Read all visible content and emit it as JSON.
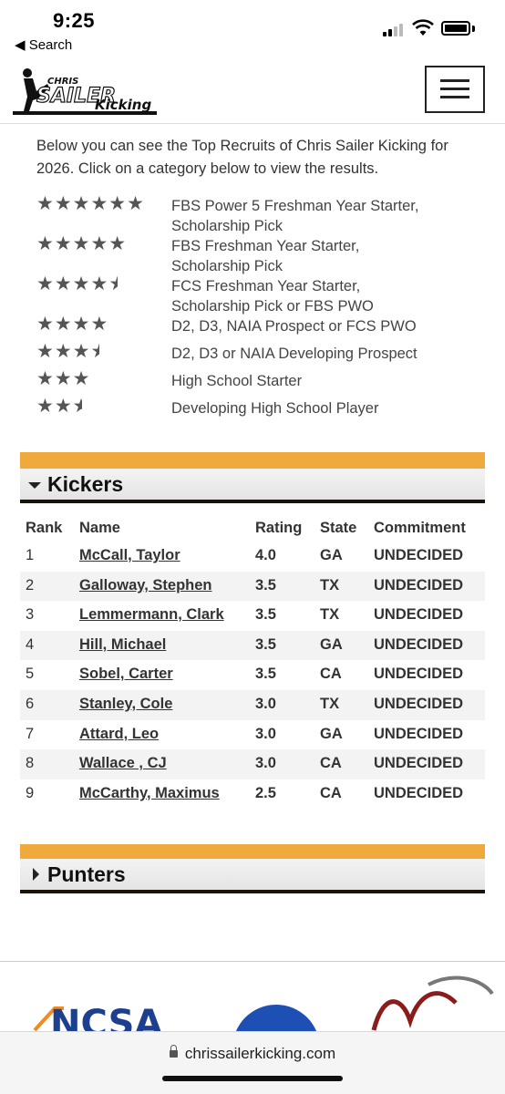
{
  "status_bar": {
    "time": "9:25",
    "back_label": "◀ Search"
  },
  "header": {
    "logo_text_top": "CHRIS",
    "logo_text_main": "SAILER",
    "logo_text_sub": "Kicking"
  },
  "intro": {
    "text": "Below you can see the Top Recruits of Chris Sailer Kicking for 2026. Click on a category below to view the results."
  },
  "legend": [
    {
      "stars": 6,
      "half": false,
      "label_lines": [
        "FBS Power 5 Freshman Year Starter,",
        "Scholarship Pick"
      ]
    },
    {
      "stars": 5,
      "half": false,
      "label_lines": [
        "FBS Freshman Year Starter,",
        "Scholarship Pick"
      ]
    },
    {
      "stars": 4,
      "half": true,
      "label_lines": [
        "FCS Freshman Year Starter,",
        "Scholarship Pick or FBS PWO"
      ]
    },
    {
      "stars": 4,
      "half": false,
      "label_lines": [
        "D2, D3, NAIA Prospect or FCS PWO"
      ]
    },
    {
      "stars": 3,
      "half": true,
      "label_lines": [
        "D2, D3 or NAIA Developing Prospect"
      ]
    },
    {
      "stars": 3,
      "half": false,
      "label_lines": [
        "High School Starter"
      ]
    },
    {
      "stars": 2,
      "half": true,
      "label_lines": [
        "Developing High School Player"
      ]
    }
  ],
  "kickers": {
    "title": "Kickers",
    "columns": [
      "Rank",
      "Name",
      "Rating",
      "State",
      "Commitment"
    ],
    "rows": [
      {
        "rank": "1",
        "name": "McCall, Taylor",
        "rating": "4.0",
        "state": "GA",
        "commitment": "UNDECIDED"
      },
      {
        "rank": "2",
        "name": "Galloway, Stephen",
        "rating": "3.5",
        "state": "TX",
        "commitment": "UNDECIDED"
      },
      {
        "rank": "3",
        "name": "Lemmermann, Clark",
        "rating": "3.5",
        "state": "TX",
        "commitment": "UNDECIDED"
      },
      {
        "rank": "4",
        "name": "Hill, Michael",
        "rating": "3.5",
        "state": "GA",
        "commitment": "UNDECIDED"
      },
      {
        "rank": "5",
        "name": "Sobel, Carter",
        "rating": "3.5",
        "state": "CA",
        "commitment": "UNDECIDED"
      },
      {
        "rank": "6",
        "name": "Stanley, Cole",
        "rating": "3.0",
        "state": "TX",
        "commitment": "UNDECIDED"
      },
      {
        "rank": "7",
        "name": "Attard, Leo",
        "rating": "3.0",
        "state": "GA",
        "commitment": "UNDECIDED"
      },
      {
        "rank": "8",
        "name": "Wallace , CJ",
        "rating": "3.0",
        "state": "CA",
        "commitment": "UNDECIDED"
      },
      {
        "rank": "9",
        "name": "McCarthy, Maximus",
        "rating": "2.5",
        "state": "CA",
        "commitment": "UNDECIDED"
      }
    ]
  },
  "punters": {
    "title": "Punters"
  },
  "partners": {
    "ncsa_text": "NCSA"
  },
  "url_bar": {
    "url": "chrissailerkicking.com"
  },
  "colors": {
    "accent_orange": "#f0a93c",
    "section_border": "#1b1209"
  }
}
